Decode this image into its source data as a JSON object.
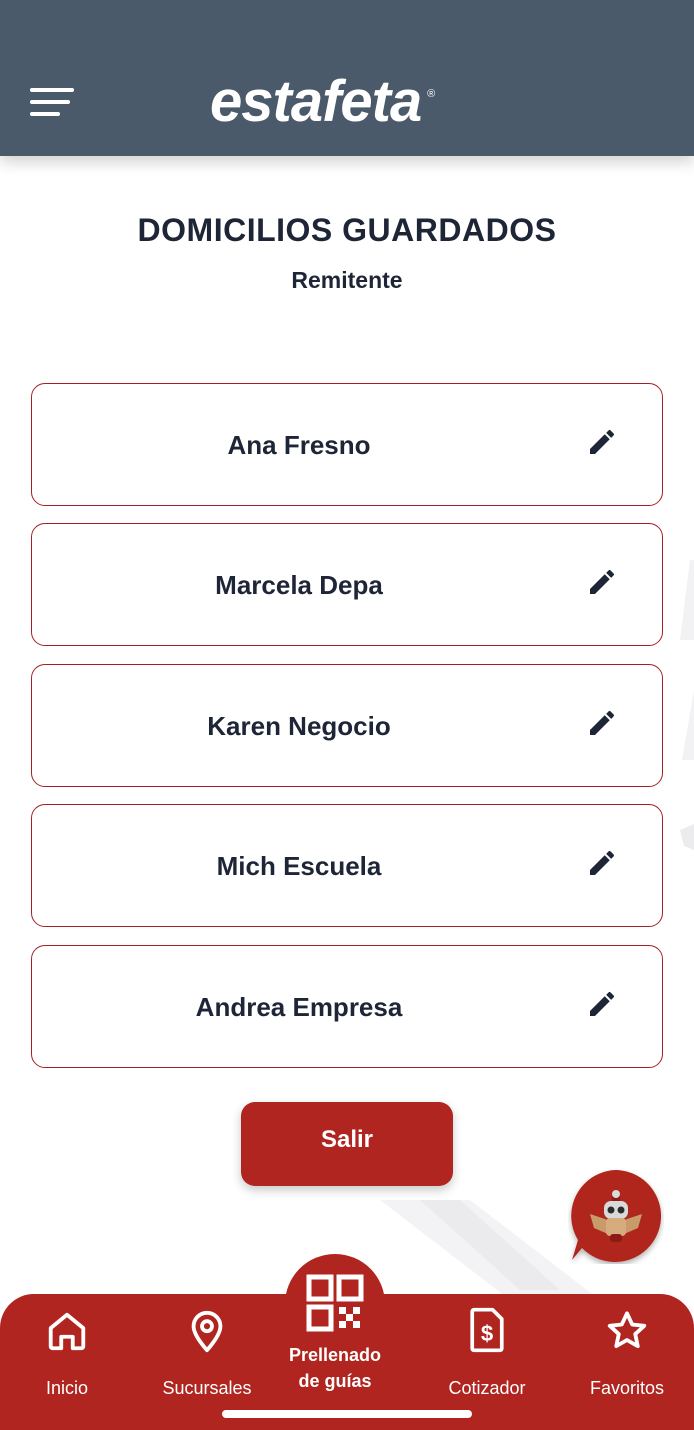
{
  "header": {
    "brand": "estafeta",
    "brand_mark": "®",
    "menu_icon": "menu-icon"
  },
  "page": {
    "title": "DOMICILIOS GUARDADOS",
    "subtitle": "Remitente"
  },
  "addresses": [
    {
      "name": "Ana Fresno",
      "icon": "pencil-edit-icon"
    },
    {
      "name": "Marcela Depa",
      "icon": "pencil-edit-icon"
    },
    {
      "name": "Karen Negocio",
      "icon": "pencil-edit-icon"
    },
    {
      "name": "Mich Escuela",
      "icon": "pencil-edit-icon"
    },
    {
      "name": "Andrea Empresa",
      "icon": "pencil-edit-icon"
    }
  ],
  "actions": {
    "exit_label": "Salir"
  },
  "chatbot": {
    "icon": "robot-chat-icon"
  },
  "bottom_nav": {
    "items": [
      {
        "label": "Inicio",
        "icon": "home-icon"
      },
      {
        "label": "Sucursales",
        "icon": "location-pin-icon"
      },
      {
        "label": "Prellenado\nde guías",
        "line1": "Prellenado",
        "line2": "de guías",
        "icon": "qr-code-icon"
      },
      {
        "label": "Cotizador",
        "icon": "dollar-document-icon"
      },
      {
        "label": "Favoritos",
        "icon": "star-icon"
      }
    ]
  },
  "colors": {
    "header_bg": "#4a5a6a",
    "accent_red": "#b0251f",
    "card_border": "#a52024",
    "text_dark": "#1e2536"
  }
}
